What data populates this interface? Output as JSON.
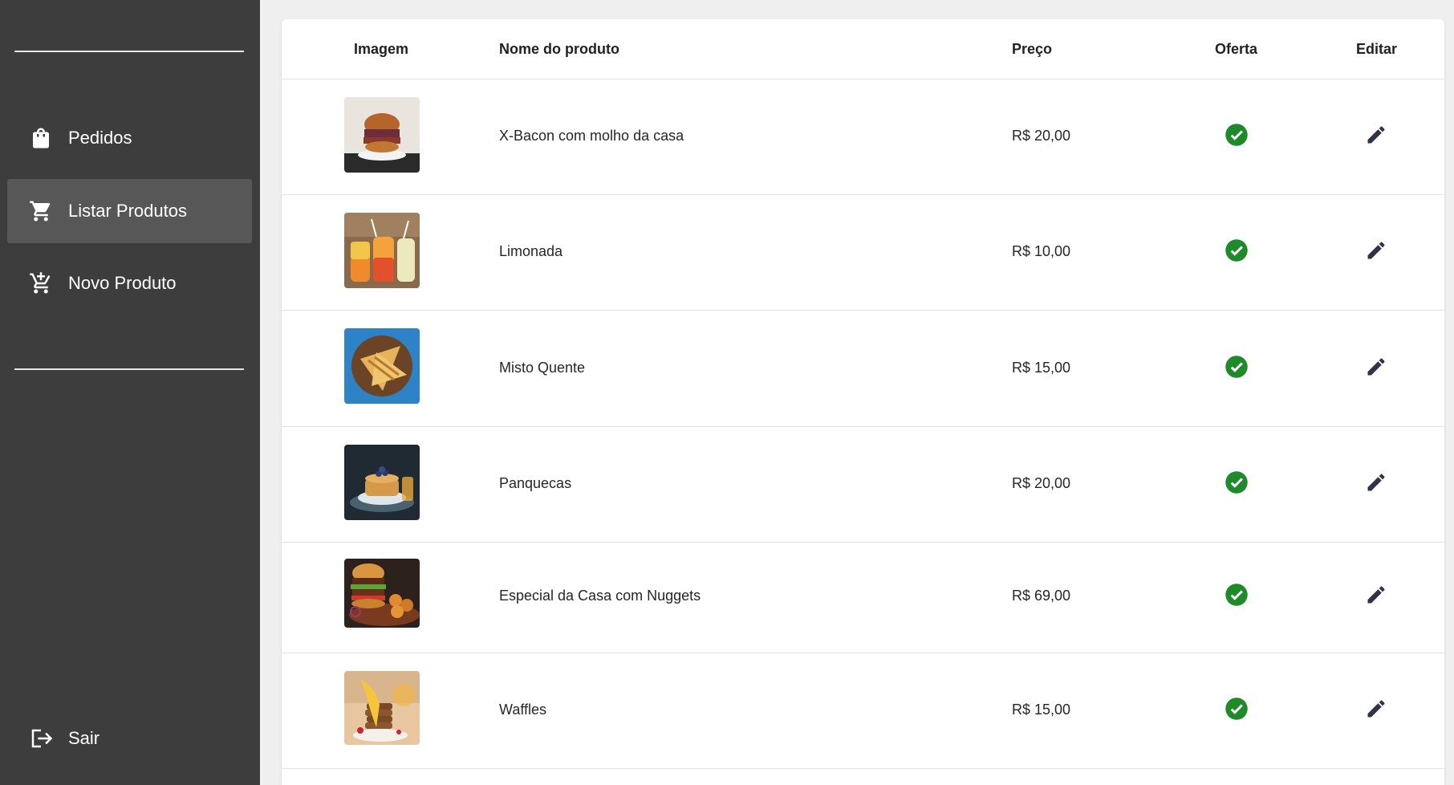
{
  "sidebar": {
    "items": [
      {
        "label": "Pedidos",
        "icon": "shopping-bag-icon"
      },
      {
        "label": "Listar Produtos",
        "icon": "shopping-cart-icon",
        "active": true
      },
      {
        "label": "Novo Produto",
        "icon": "add-shopping-cart-icon"
      }
    ],
    "logout_label": "Sair"
  },
  "table": {
    "headers": {
      "image": "Imagem",
      "name": "Nome do produto",
      "price": "Preço",
      "offer": "Oferta",
      "edit": "Editar"
    },
    "rows": [
      {
        "name": "X-Bacon com molho da casa",
        "price": "R$ 20,00",
        "offer": true
      },
      {
        "name": "Limonada",
        "price": "R$ 10,00",
        "offer": true
      },
      {
        "name": "Misto Quente",
        "price": "R$ 15,00",
        "offer": true
      },
      {
        "name": "Panquecas",
        "price": "R$ 20,00",
        "offer": true
      },
      {
        "name": "Especial da Casa com Nuggets",
        "price": "R$ 69,00",
        "offer": true
      },
      {
        "name": "Waffles",
        "price": "R$ 15,00",
        "offer": true
      }
    ]
  },
  "colors": {
    "sidebar_bg": "#3d3d3d",
    "sidebar_active": "#575757",
    "check_green": "#1f8a2a",
    "edit_icon": "#2e3446"
  }
}
